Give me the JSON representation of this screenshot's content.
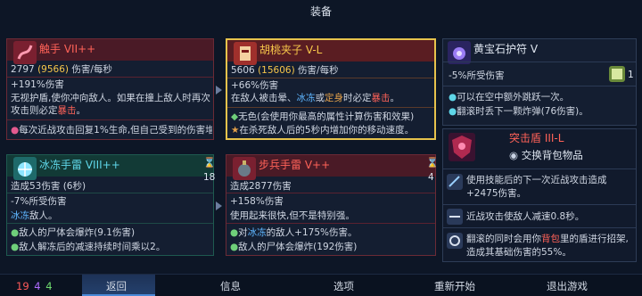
{
  "title": "装备",
  "colors": {
    "red": "#ff6258",
    "blue": "#5fb6ff",
    "gold": "#f6c64a",
    "cyan": "#5fd6e8",
    "pink": "#e35a8f",
    "green": "#6fcf7a"
  },
  "cards": {
    "tentacle": {
      "name": "触手 VII++",
      "dps_a": "2797",
      "dps_b": "(9566)",
      "dps_suffix": "伤害/每秒",
      "bonus": "+191%伤害",
      "desc1": "无视护盾,使你冲向敌人。如果在撞上敌人时再次",
      "desc2_a": "攻击则必定",
      "desc2_b": "暴击",
      "desc2_c": "。",
      "effect": "每次近战攻击回复1%生命,但自己受到的伤害增"
    },
    "nutcracker": {
      "name": "胡桃夹子 V-L",
      "dps_a": "5606",
      "dps_b": "(15606)",
      "dps_suffix": "伤害/每秒",
      "bonus": "+66%伤害",
      "desc_a": "在敌人被击晕、",
      "desc_b": "冰冻",
      "desc_c": "或",
      "desc_d": "定身",
      "desc_e": "时必定",
      "desc_f": "暴击",
      "desc_g": "。",
      "aff1": "无色(会使用你最高的属性计算伤害和效果)",
      "aff2": "在杀死敌人后的5秒内增加你的移动速度。"
    },
    "amulet": {
      "name": "黄宝石护符 V",
      "stat": "-5%所受伤害",
      "scroll_count": "1",
      "l1": "可以在空中额外跳跃一次。",
      "l2": "翻滚时丢下一颗炸弹(76伤害)。"
    },
    "frost": {
      "name": "冰冻手雷 VIII++",
      "count": "18",
      "stat": "造成53伤害 (6秒)",
      "stat2": "-7%所受伤害",
      "desc_a": "冰冻",
      "desc_b": "敌人。",
      "l1": "敌人的尸体会爆炸(9.1伤害)",
      "l2": "敌人解冻后的减速持续时间乘以2。"
    },
    "infantry": {
      "name": "步兵手雷 V++",
      "count": "4",
      "stat": "造成2877伤害",
      "bonus": "+158%伤害",
      "desc": "使用起来很快,但不是特别强。",
      "l1_a": "对",
      "l1_b": "冰冻",
      "l1_c": "的敌人+175%伤害。",
      "l2": "敌人的尸体会爆炸(192伤害)"
    },
    "shield": {
      "name": "突击盾 III-L",
      "swap": "交换背包物品",
      "p1_a": "使用技能后的下一次近战攻击造成",
      "p1_b": "+2475伤害。",
      "p2": "近战攻击使敌人减速0.8秒。",
      "p3_a": "翻滚的同时会用你",
      "p3_b": "背包",
      "p3_c": "里的盾进行招架,",
      "p3_d": "造成其基础伤害的55%。"
    }
  },
  "stats": {
    "brutality": "19",
    "tactics": "4",
    "survival": "4"
  },
  "menu": {
    "back": "返回",
    "info": "信息",
    "options": "选项",
    "restart": "重新开始",
    "quit": "退出游戏"
  }
}
